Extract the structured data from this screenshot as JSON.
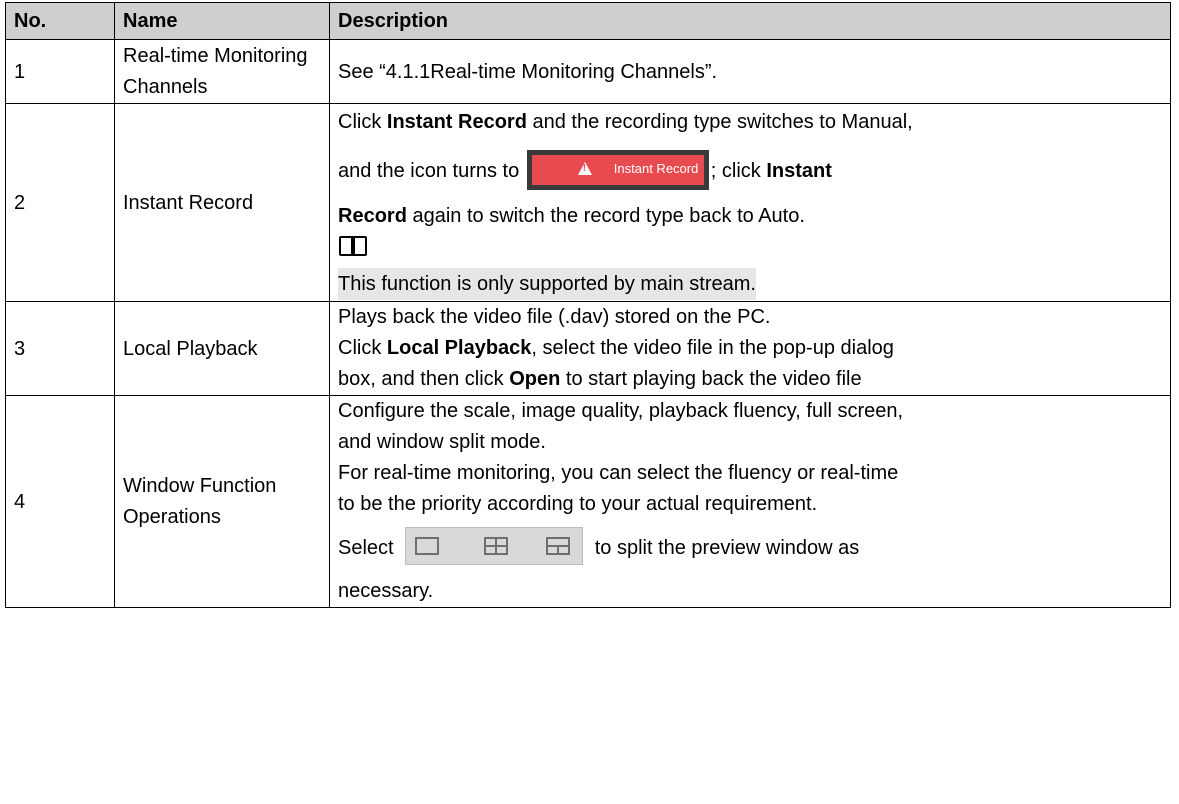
{
  "header": {
    "no": "No.",
    "name": "Name",
    "description": "Description"
  },
  "rows": [
    {
      "no": "1",
      "name": "Real-time Monitoring Channels",
      "desc": "See “4.1.1Real-time Monitoring Channels”."
    },
    {
      "no": "2",
      "name": "Instant Record",
      "desc_parts": {
        "a1": "Click ",
        "b1": "Instant Record",
        "a2": " and the recording type switches to Manual,",
        "a3": "and the icon turns to ",
        "btn": "Instant Record",
        "a4": "; click ",
        "b2": "Instant",
        "b3": "Record",
        "a5": " again to switch the record type back to Auto.",
        "note": "This function is only supported by main stream."
      }
    },
    {
      "no": "3",
      "name": "Local Playback",
      "desc_parts": {
        "l1": "Plays back the video file (.dav) stored on the PC.",
        "a1": "Click ",
        "b1": "Local Playback",
        "a2": ", select the video file in the pop-up dialog",
        "a3": "box, and then click ",
        "b2": "Open",
        "a4": " to start playing back the video file"
      }
    },
    {
      "no": "4",
      "name": "Window Function Operations",
      "desc_parts": {
        "l1": "Configure the scale, image quality, playback fluency, full screen,",
        "l2": "and window split mode.",
        "l3": "For real-time monitoring, you can select the fluency or real-time",
        "l4": "to be the priority according to your actual requirement.",
        "a1": "Select ",
        "a2": " to split the preview window as",
        "l5": "necessary."
      }
    }
  ]
}
